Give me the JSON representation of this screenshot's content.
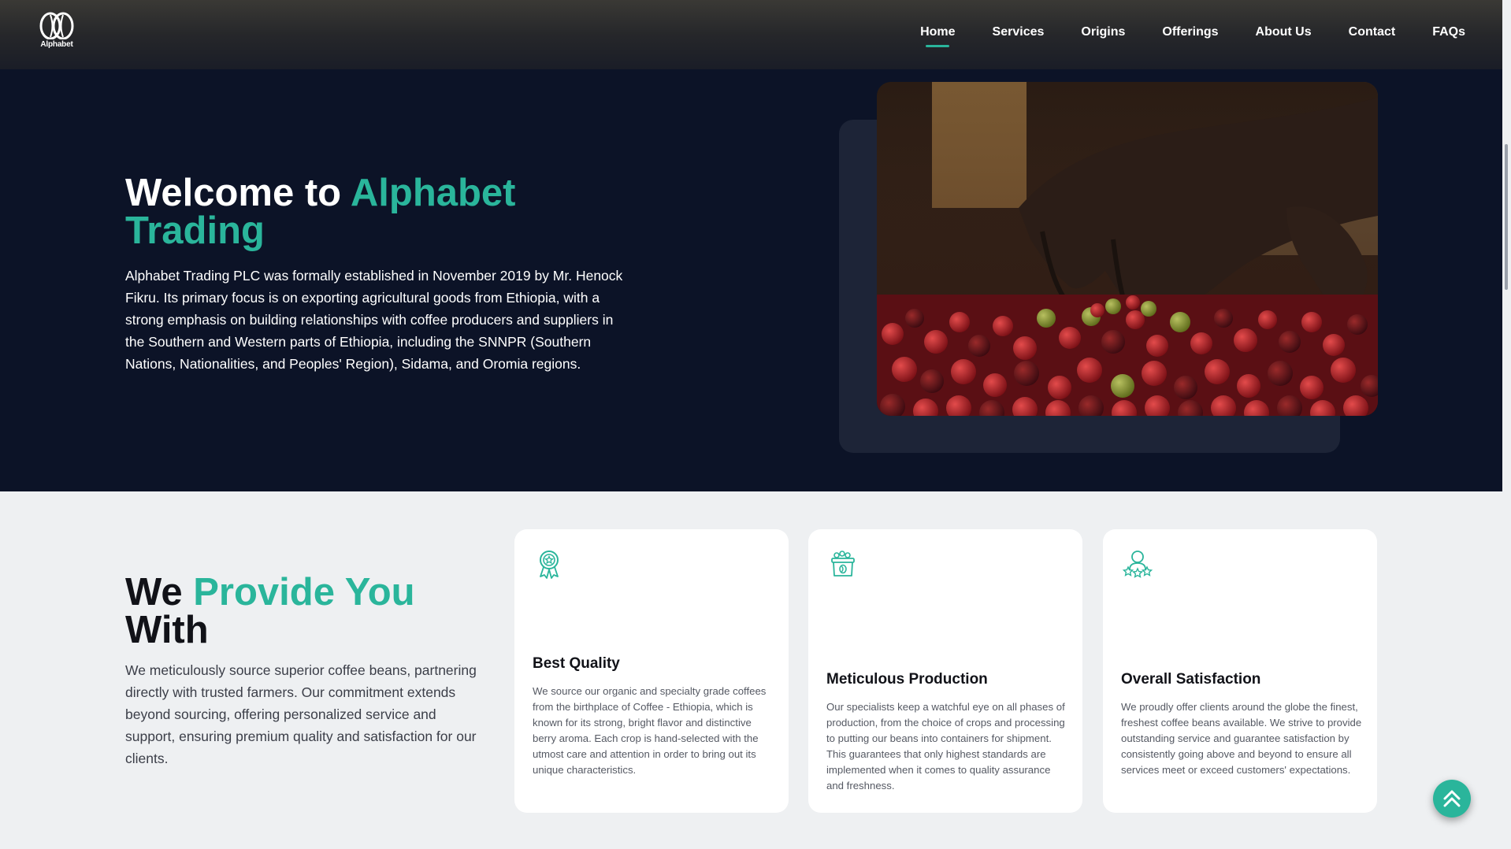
{
  "brand": {
    "logo_text": "Alphabet",
    "accent": "#2ab59b"
  },
  "nav": {
    "items": [
      {
        "label": "Home",
        "active": true
      },
      {
        "label": "Services"
      },
      {
        "label": "Origins"
      },
      {
        "label": "Offerings"
      },
      {
        "label": "About Us"
      },
      {
        "label": "Contact"
      },
      {
        "label": "FAQs"
      }
    ]
  },
  "hero": {
    "title_plain": "Welcome to ",
    "title_accent": "Alphabet Trading",
    "description": "Alphabet Trading PLC was formally established in November 2019 by Mr. Henock Fikru. Its primary focus is on exporting agricultural goods from Ethiopia, with a strong emphasis on building relationships with coffee producers and suppliers in the Southern and Western parts of Ethiopia, including the SNNPR (Southern Nations, Nationalities, and Peoples' Region), Sidama, and Oromia regions."
  },
  "provide": {
    "title_plain_1": "We ",
    "title_accent": "Provide You",
    "title_plain_2": "With",
    "description": "We meticulously source superior coffee beans, partnering directly with trusted farmers. Our commitment extends beyond sourcing, offering personalized service and support, ensuring premium quality and satisfaction for our clients.",
    "cards": [
      {
        "icon": "award-ribbon-icon",
        "title": "Best Quality",
        "text": "We source our organic and specialty grade coffees from the birthplace of Coffee - Ethiopia, which is known for its strong, bright flavor and distinctive berry aroma. Each crop is hand-selected with the utmost care and attention in order to bring out its unique characteristics."
      },
      {
        "icon": "coffee-basket-icon",
        "title": "Meticulous Production",
        "text": "Our specialists keep a watchful eye on all phases of production, from the choice of crops and processing to putting our beans into containers for shipment. This guarantees that only highest standards are implemented when it comes to quality assurance and freshness."
      },
      {
        "icon": "satisfied-customer-icon",
        "title": "Overall Satisfaction",
        "text": "We proudly offer clients around the globe the finest, freshest coffee beans available. We strive to provide outstanding service and guarantee satisfaction by consistently going above and beyond to ensure all services meet or exceed customers' expectations."
      }
    ]
  }
}
